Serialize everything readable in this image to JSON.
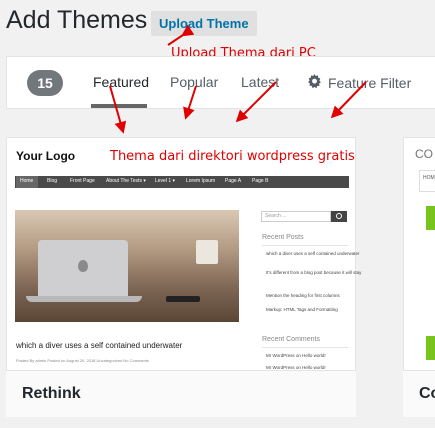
{
  "header": {
    "title": "Add Themes",
    "upload_button": "Upload Theme"
  },
  "annotations": {
    "upload": "Upload Thema dari PC",
    "directory": "Thema dari direktori wordpress gratis"
  },
  "filter_bar": {
    "count": "15",
    "tabs": [
      "Featured",
      "Popular",
      "Latest"
    ],
    "feature_filter": "Feature Filter",
    "active_tab": "Featured"
  },
  "themes": [
    {
      "name": "Rethink",
      "preview": {
        "logo": "Your Logo",
        "nav": [
          "Home",
          "Blog",
          "Front Page",
          "About The Tests ▾",
          "Level 1 ▾",
          "Lorem Ipsum",
          "Page A",
          "Page B"
        ],
        "post_title": "which a diver uses a self contained underwater",
        "post_meta": "Posted By admin   Posted on August 20, 2018   Uncategorized   No Comments",
        "search_placeholder": "Search ...",
        "recent_posts_heading": "Recent Posts",
        "recent_posts": [
          "which a diver uses a self contained underwater",
          "It's different from a blog post because it will stay",
          "Mention the heading for first columns",
          "Markup: HTML Tags and Formatting"
        ],
        "recent_comments_heading": "Recent Comments",
        "recent_comments": [
          "Mr WordPress on Hello world!",
          "Mr WordPress on Hello world!"
        ]
      }
    },
    {
      "name": "Co",
      "preview": {
        "label": "CO",
        "nav": "HOM"
      }
    }
  ],
  "colors": {
    "accent": "#0073aa",
    "annotation": "#e00000",
    "badge": "#72777c"
  }
}
